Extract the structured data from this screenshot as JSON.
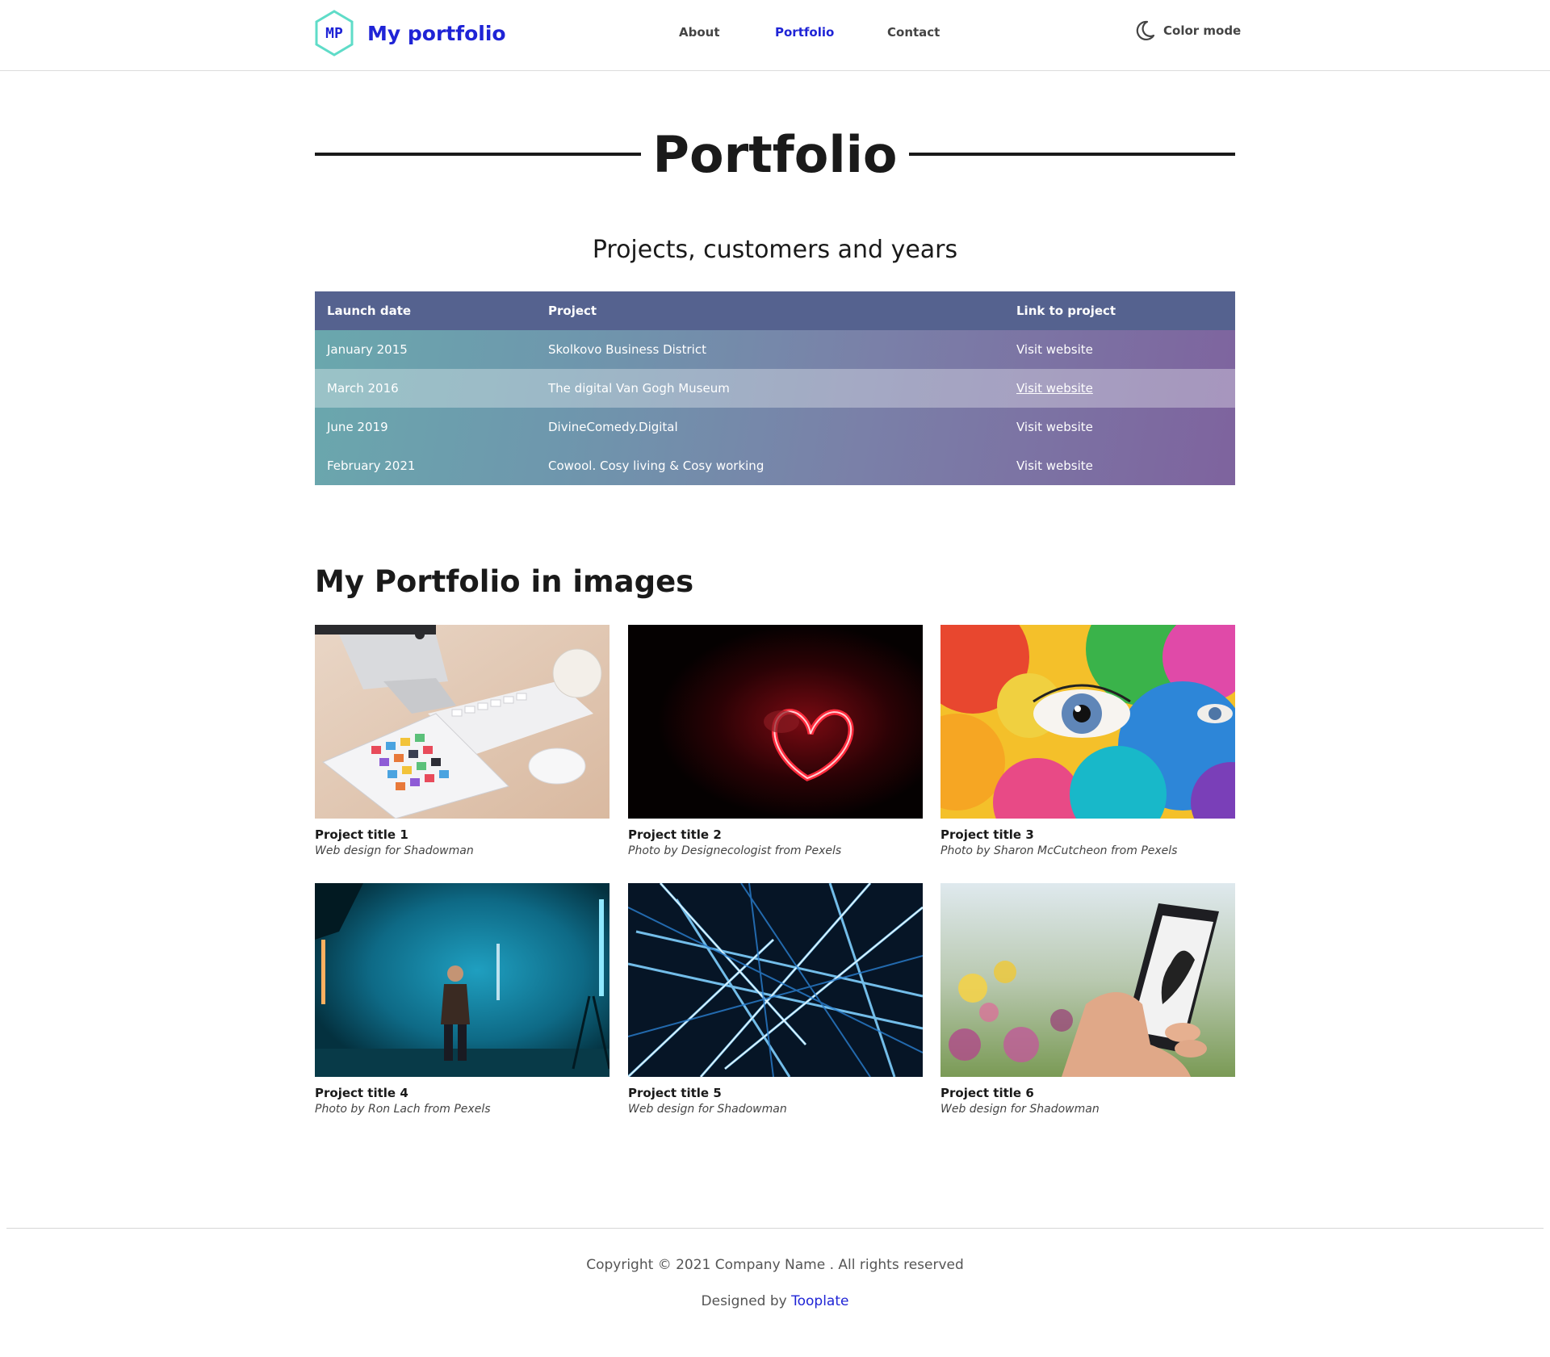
{
  "header": {
    "logo_letters": "MP",
    "brand_name": "My portfolio",
    "nav": [
      {
        "label": "About",
        "active": false
      },
      {
        "label": "Portfolio",
        "active": true
      },
      {
        "label": "Contact",
        "active": false
      }
    ],
    "color_mode_label": "Color mode",
    "colors": {
      "brand": "#1f24d6",
      "logo_hex": "#5fdcc8"
    }
  },
  "hero": {
    "title": "Portfolio",
    "subtitle": "Projects, customers and years"
  },
  "table": {
    "headers": [
      "Launch date",
      "Project",
      "Link to project"
    ],
    "rows": [
      {
        "date": "January 2015",
        "project": "Skolkovo Business District",
        "link": "Visit website"
      },
      {
        "date": "March 2016",
        "project": "The digital Van Gogh Museum",
        "link": "Visit website"
      },
      {
        "date": "June 2019",
        "project": "DivineComedy.Digital",
        "link": "Visit website"
      },
      {
        "date": "February 2021",
        "project": "Cowool. Cosy living & Cosy working",
        "link": "Visit website"
      }
    ],
    "highlighted_row": 1
  },
  "gallery": {
    "title": "My Portfolio in images",
    "items": [
      {
        "title": "Project title 1",
        "credit": "Web design for Shadowman"
      },
      {
        "title": "Project title 2",
        "credit": "Photo by Designecologist from Pexels"
      },
      {
        "title": "Project title 3",
        "credit": "Photo by Sharon McCutcheon from Pexels"
      },
      {
        "title": "Project title 4",
        "credit": "Photo by Ron Lach from Pexels"
      },
      {
        "title": "Project title 5",
        "credit": "Web design for Shadowman"
      },
      {
        "title": "Project title 6",
        "credit": "Web design for Shadowman"
      }
    ]
  },
  "footer": {
    "copyright": "Copyright © 2021 Company Name . All rights reserved",
    "designed_by_prefix": "Designed by ",
    "designed_by_link": "Tooplate"
  }
}
